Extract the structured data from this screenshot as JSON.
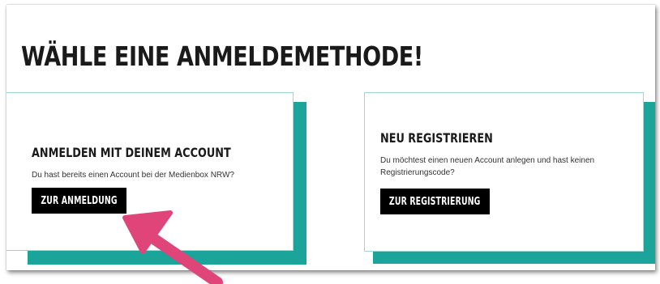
{
  "page": {
    "title": "WÄHLE EINE ANMELDEMETHODE!"
  },
  "login_card": {
    "heading": "ANMELDEN MIT DEINEM ACCOUNT",
    "text": "Du hast bereits einen Account bei der Medienbox NRW?",
    "button_label": "ZUR ANMELDUNG"
  },
  "register_card": {
    "heading": "NEU REGISTRIEREN",
    "text": "Du möchtest einen neuen Account anlegen und hast keinen Registrierungscode?",
    "button_label": "ZUR REGISTRIERUNG"
  },
  "colors": {
    "accent": "#1aa49a",
    "button_bg": "#000000",
    "annotation_arrow": "#e0457a"
  },
  "annotation": {
    "icon": "arrow-up-left-icon"
  }
}
